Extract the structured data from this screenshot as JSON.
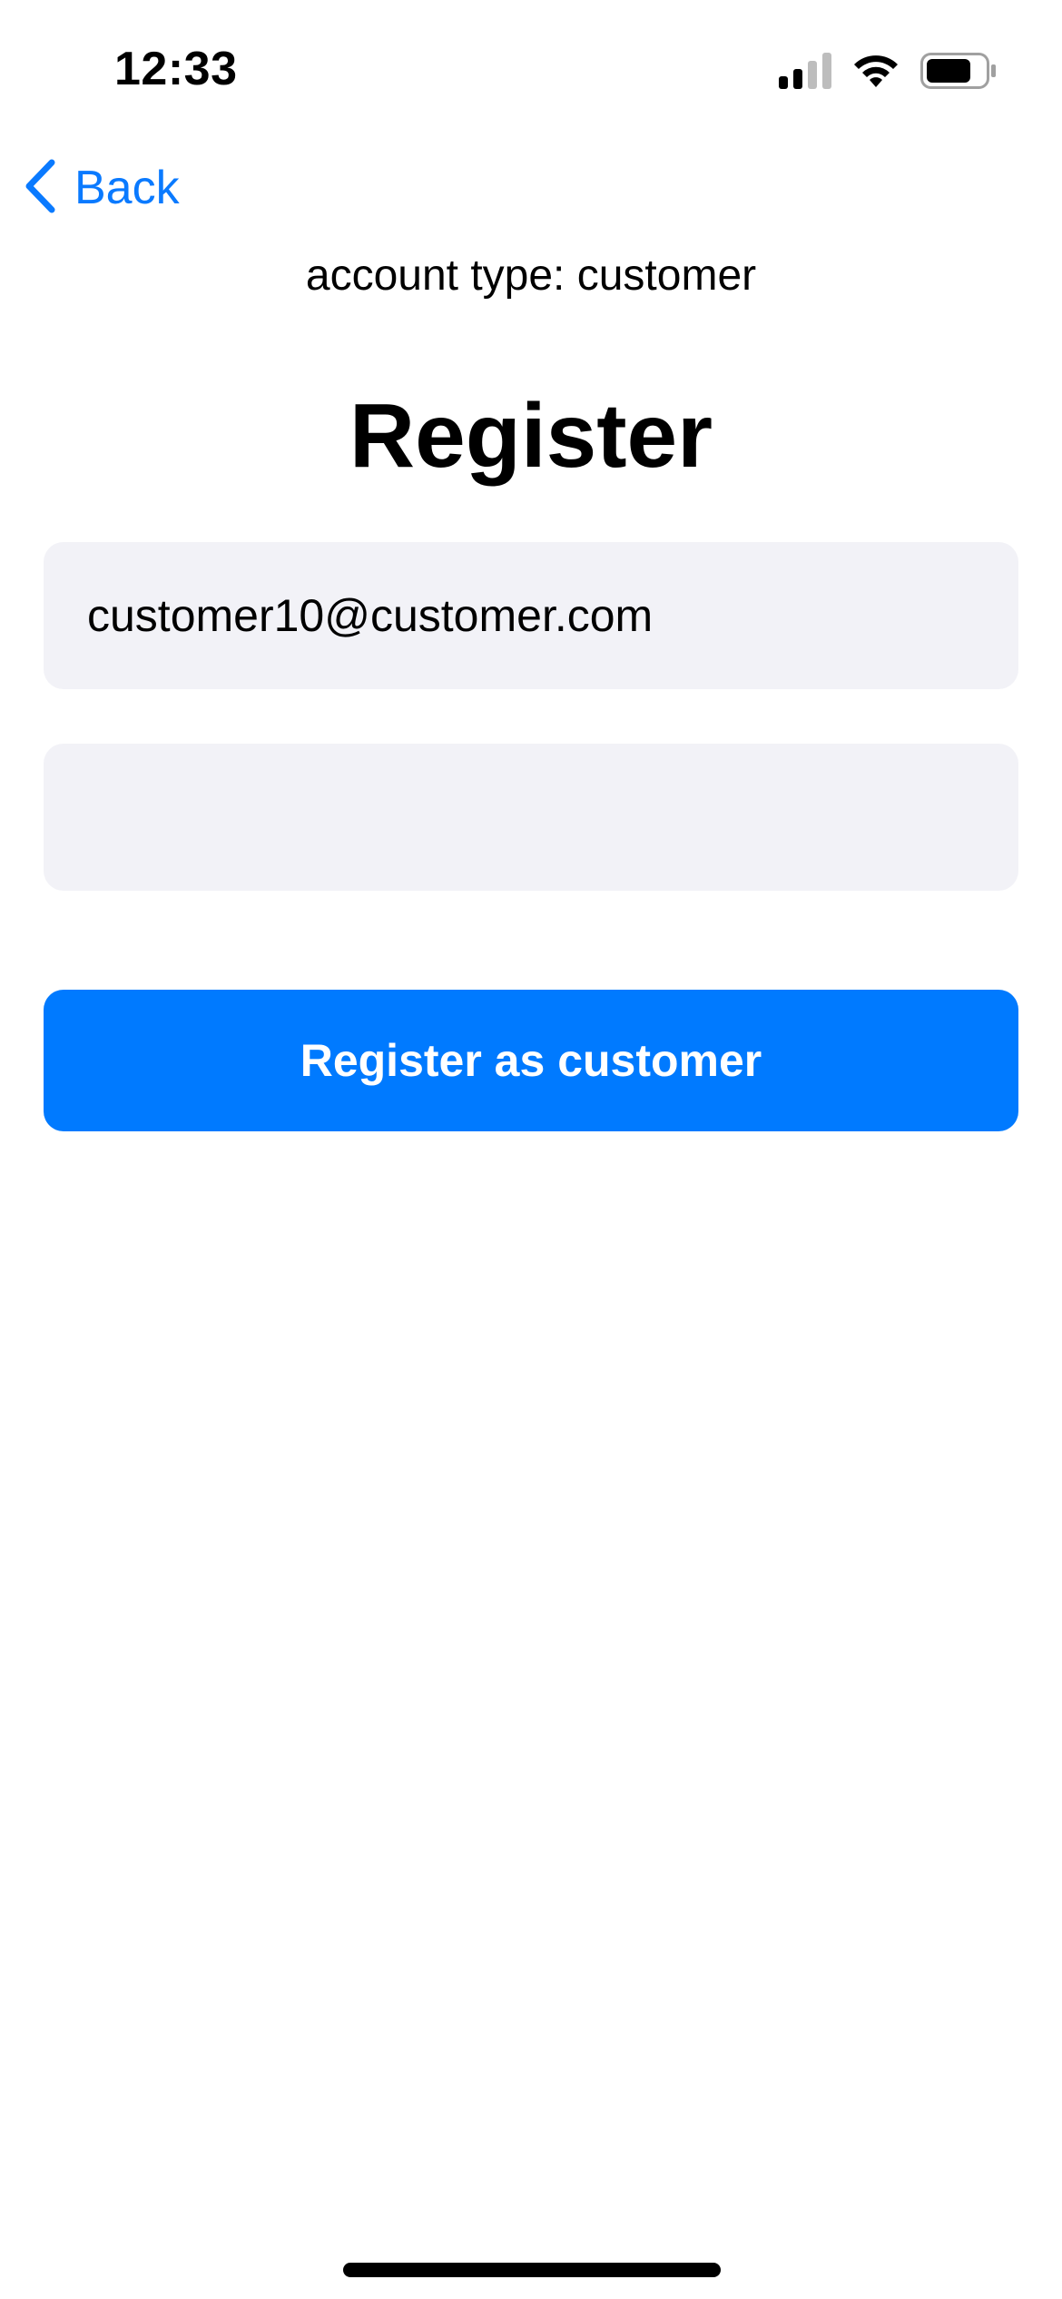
{
  "status_bar": {
    "time": "12:33",
    "icons": [
      "cellular-signal-icon",
      "wifi-icon",
      "battery-icon"
    ]
  },
  "nav": {
    "back_label": "Back",
    "back_icon": "chevron-left-icon"
  },
  "account_type_text": "account type: customer",
  "page_title": "Register",
  "form": {
    "email_value": "customer10@customer.com",
    "password_value": ""
  },
  "register_button_label": "Register as customer",
  "colors": {
    "accent": "#007AFF",
    "field_background": "#F2F2F7",
    "background": "#FFFFFF",
    "text": "#000000"
  }
}
